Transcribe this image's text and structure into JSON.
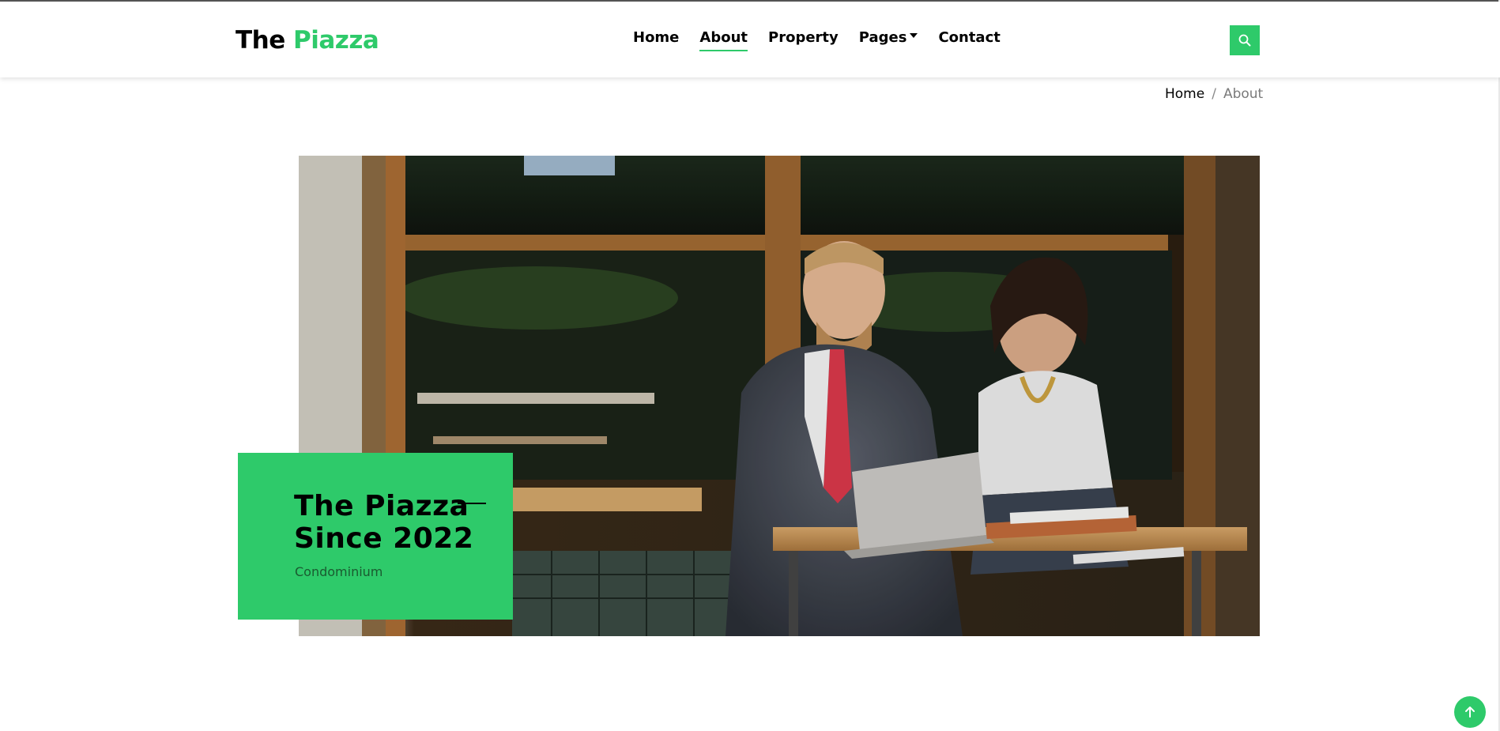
{
  "brand": {
    "part1": "The",
    "part2": "Piazza"
  },
  "nav": {
    "items": [
      {
        "label": "Home",
        "active": false
      },
      {
        "label": "About",
        "active": true
      },
      {
        "label": "Property",
        "active": false
      },
      {
        "label": "Pages",
        "active": false,
        "dropdown": true
      },
      {
        "label": "Contact",
        "active": false
      }
    ]
  },
  "breadcrumb": {
    "home": "Home",
    "separator": "/",
    "current": "About"
  },
  "hero": {
    "title_line1": "The Piazza",
    "title_line2": "Since 2022",
    "subtitle": "Condominium"
  },
  "colors": {
    "accent": "#2eca6a",
    "text": "#000000"
  },
  "icons": {
    "search": "search-icon",
    "to_top": "arrow-up-icon",
    "dropdown": "caret-down-icon"
  }
}
